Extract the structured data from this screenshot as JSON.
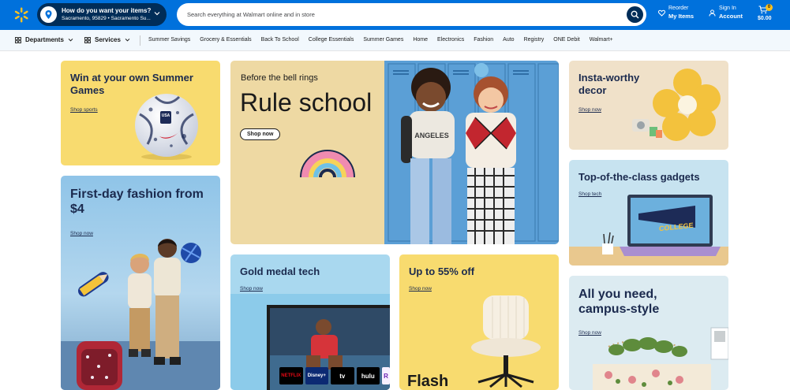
{
  "header": {
    "location_question": "How do you want your items?",
    "location_address": "Sacramento, 95829 • Sacramento Su...",
    "search_placeholder": "Search everything at Walmart online and in store",
    "reorder_line1": "Reorder",
    "reorder_line2": "My Items",
    "signin_line1": "Sign In",
    "signin_line2": "Account",
    "cart_count": "0",
    "cart_total": "$0.00"
  },
  "subnav": {
    "departments": "Departments",
    "services": "Services",
    "links": [
      "Summer Savings",
      "Grocery & Essentials",
      "Back To School",
      "College Essentials",
      "Summer Games",
      "Home",
      "Electronics",
      "Fashion",
      "Auto",
      "Registry",
      "ONE Debit",
      "Walmart+"
    ]
  },
  "cards": {
    "summer_games": {
      "title": "Win at your own Summer Games",
      "link": "Shop sports"
    },
    "fashion": {
      "title": "First-day fashion from $4",
      "link": "Shop now"
    },
    "hero": {
      "kicker": "Before the bell rings",
      "title": "Rule school",
      "button": "Shop now"
    },
    "insta_decor": {
      "title": "Insta-worthy decor",
      "link": "Shop now"
    },
    "gadgets": {
      "title": "Top-of-the-class gadgets",
      "link": "Shop tech",
      "pennant": "COLLEGE"
    },
    "gold_tech": {
      "title": "Gold medal tech",
      "link": "Shop now",
      "logos": [
        "NETFLIX",
        "Disney+",
        "tv",
        "hulu",
        "R"
      ]
    },
    "chairs": {
      "title": "Up to 55% off",
      "link": "Shop now",
      "footer": "Flash"
    },
    "campus": {
      "title": "All you need, campus-style",
      "link": "Shop now"
    }
  },
  "colors": {
    "brand_blue": "#0071dc",
    "dark_blue": "#002d58",
    "spark_yellow": "#ffc220",
    "title_navy": "#1b2a4e"
  }
}
